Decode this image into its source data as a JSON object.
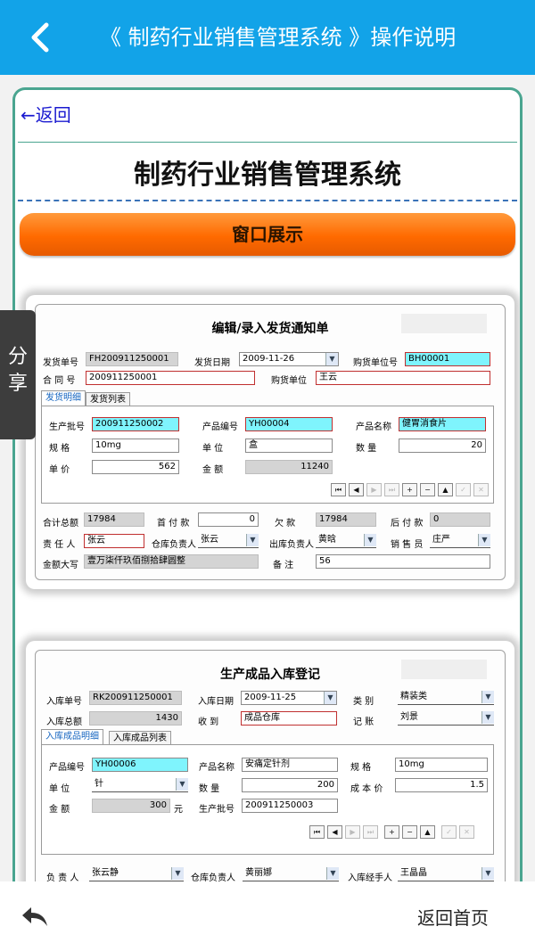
{
  "topbar": {
    "title": "《 制药行业销售管理系统 》操作说明"
  },
  "content": {
    "back_link": "←返回",
    "title": "制药行业销售管理系统",
    "section": "窗口展示"
  },
  "share_label": "分享",
  "bottom": {
    "home": "返回首页"
  },
  "win1": {
    "title": "编辑/录入发货通知单",
    "fields": {
      "ship_no_label": "发货单号",
      "ship_no": "FH200911250001",
      "ship_date_label": "发货日期",
      "ship_date": "2009-11-26",
      "buyer_no_label": "购货单位号",
      "buyer_no": "BH00001",
      "contract_label": "合 同 号",
      "contract": "200911250001",
      "buyer_label": "购货单位",
      "buyer": "王云"
    },
    "tabs": [
      "发货明细",
      "发货列表"
    ],
    "detail": {
      "batch_label": "生产批号",
      "batch": "200911250002",
      "prod_no_label": "产品编号",
      "prod_no": "YH00004",
      "prod_name_label": "产品名称",
      "prod_name": "健胃消食片",
      "spec_label": "规    格",
      "spec": "10mg",
      "unit_label": "单    位",
      "unit": "盒",
      "qty_label": "数    量",
      "qty": "20",
      "price_label": "单    价",
      "price": "562",
      "amount_label": "金    额",
      "amount": "11240"
    },
    "summary": {
      "total_label": "合计总额",
      "total": "17984",
      "down_label": "首 付 款",
      "down": "0",
      "owe_label": "欠    款",
      "owe": "17984",
      "later_label": "后 付 款",
      "later": "0",
      "resp_label": "责 任 人",
      "resp": "张云",
      "wh_label": "仓库负责人",
      "wh": "张云",
      "out_label": "出库负责人",
      "out": "黄晗",
      "sales_label": "销 售 员",
      "sales": "庄严",
      "cap_label": "金额大写",
      "cap": "壹万柒仟玖佰捌拾肆圆整",
      "note_label": "备    注",
      "note": "56"
    }
  },
  "win2": {
    "title": "生产成品入库登记",
    "fields": {
      "in_no_label": "入库单号",
      "in_no": "RK200911250001",
      "in_date_label": "入库日期",
      "in_date": "2009-11-25",
      "type_label": "类    别",
      "type": "精装类",
      "in_total_label": "入库总额",
      "in_total": "1430",
      "recv_label": "收    到",
      "recv": "成品仓库",
      "acct_label": "记    账",
      "acct": "刘景"
    },
    "tabs": [
      "入库成品明细",
      "入库成品列表"
    ],
    "detail": {
      "prod_no_label": "产品编号",
      "prod_no": "YH00006",
      "prod_name_label": "产品名称",
      "prod_name": "安痛定针剂",
      "spec_label": "规    格",
      "spec": "10mg",
      "unit_label": "单    位",
      "unit": "针",
      "qty_label": "数    量",
      "qty": "200",
      "cost_label": "成 本 价",
      "cost": "1.5",
      "amount_label": "金    额",
      "amount": "300",
      "yuan": "元",
      "batch_label": "生产批号",
      "batch": "200911250003"
    },
    "footer": {
      "resp_label": "负 责 人",
      "resp": "张云静",
      "wh_label": "仓库负责人",
      "wh": "黄丽娜",
      "handler_label": "入库经手人",
      "handler": "王晶晶"
    }
  },
  "nav_buttons": [
    "⏮",
    "◀",
    "▶",
    "⏭",
    "+",
    "−",
    "▲",
    "✓",
    "✕"
  ],
  "colors": {
    "topbar": "#12a3e8",
    "banner": "#ff7a10",
    "frame": "#4aa590",
    "cyan_field": "#7ff4fd"
  },
  "icons": {
    "back": "chevron-left-icon",
    "bottom_back": "reply-arrow-icon"
  }
}
